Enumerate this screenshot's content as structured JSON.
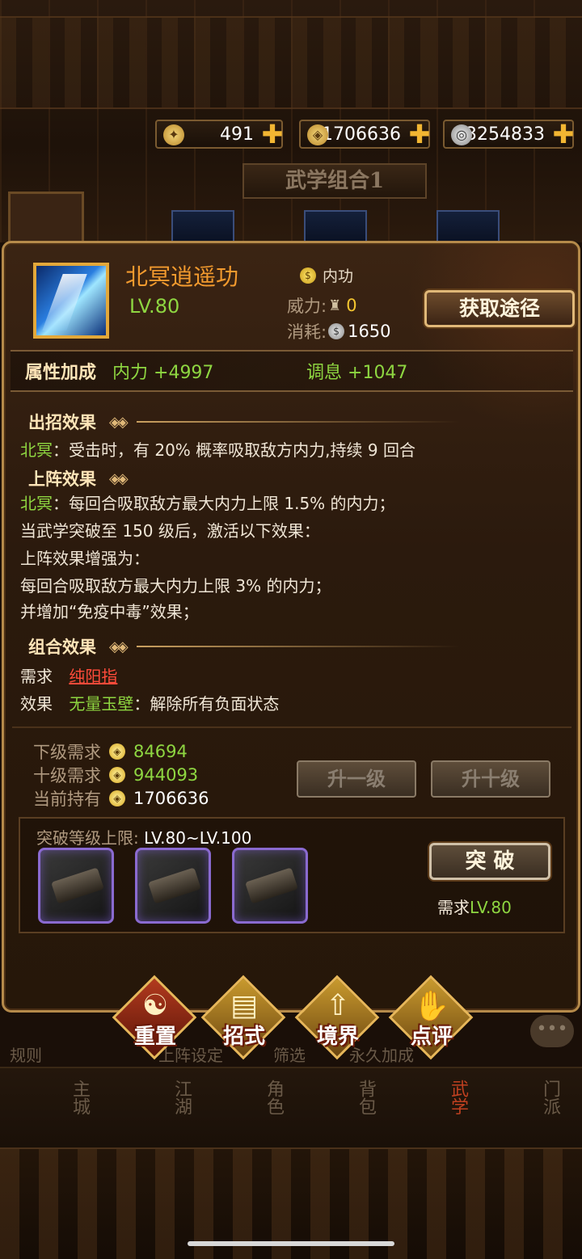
{
  "currency": {
    "stamina": "491",
    "gold": "1706636",
    "silver": "3254833"
  },
  "combo_title": "武学组合1",
  "skill": {
    "name": "北冥逍遥功",
    "level": "LV.80",
    "type": "内功",
    "power_label": "威力:",
    "power_value": "0",
    "cost_label": "消耗:",
    "cost_value": "1650",
    "obtain_button": "获取途径"
  },
  "attributes": {
    "label": "属性加成",
    "stat1": "内力 +4997",
    "stat2": "调息 +1047"
  },
  "attack_effect": {
    "title": "出招效果",
    "prefix": "北冥",
    "text": "：受击时，有 20% 概率吸取敌方内力,持续 9 回合"
  },
  "deploy_effect": {
    "title": "上阵效果",
    "line1_prefix": "北冥",
    "line1": "：每回合吸取敌方最大内力上限 1.5% 的内力；",
    "line2": "当武学突破至 150 级后，激活以下效果：",
    "line3": "上阵效果增强为：",
    "line4": "每回合吸取敌方最大内力上限 3% 的内力；",
    "line5": "并增加“免疫中毒”效果；"
  },
  "combo_effect": {
    "title": "组合效果",
    "require_label": "需求",
    "require_value": "纯阳指",
    "effect_label": "效果",
    "effect_name": "无量玉壁",
    "effect_text": "：解除所有负面状态"
  },
  "upgrade": {
    "next_label": "下级需求",
    "next_value": "84694",
    "ten_label": "十级需求",
    "ten_value": "944093",
    "have_label": "当前持有",
    "have_value": "1706636",
    "up1_button": "升一级",
    "up10_button": "升十级"
  },
  "breakthrough": {
    "title_label": "突破等级上限:",
    "title_value": "LV.80~LV.100",
    "button": "突 破",
    "need_label": "需求",
    "need_value": "LV.80"
  },
  "actions": {
    "reset": "重置",
    "moves": "招式",
    "realm": "境界",
    "review": "点评"
  },
  "behind_labels": {
    "rules": "规则",
    "deploy": "上阵设定",
    "filter": "筛选",
    "permanent": "永久加成"
  },
  "nav": {
    "city": "主城",
    "jianghu": "江湖",
    "role": "角色",
    "bag": "背包",
    "wuxue": "武学",
    "sect": "门派"
  },
  "colors": {
    "accent_orange": "#f29a2e",
    "green": "#8ed641",
    "gold_border": "#e0b878",
    "red_link": "#ff4b3a"
  }
}
